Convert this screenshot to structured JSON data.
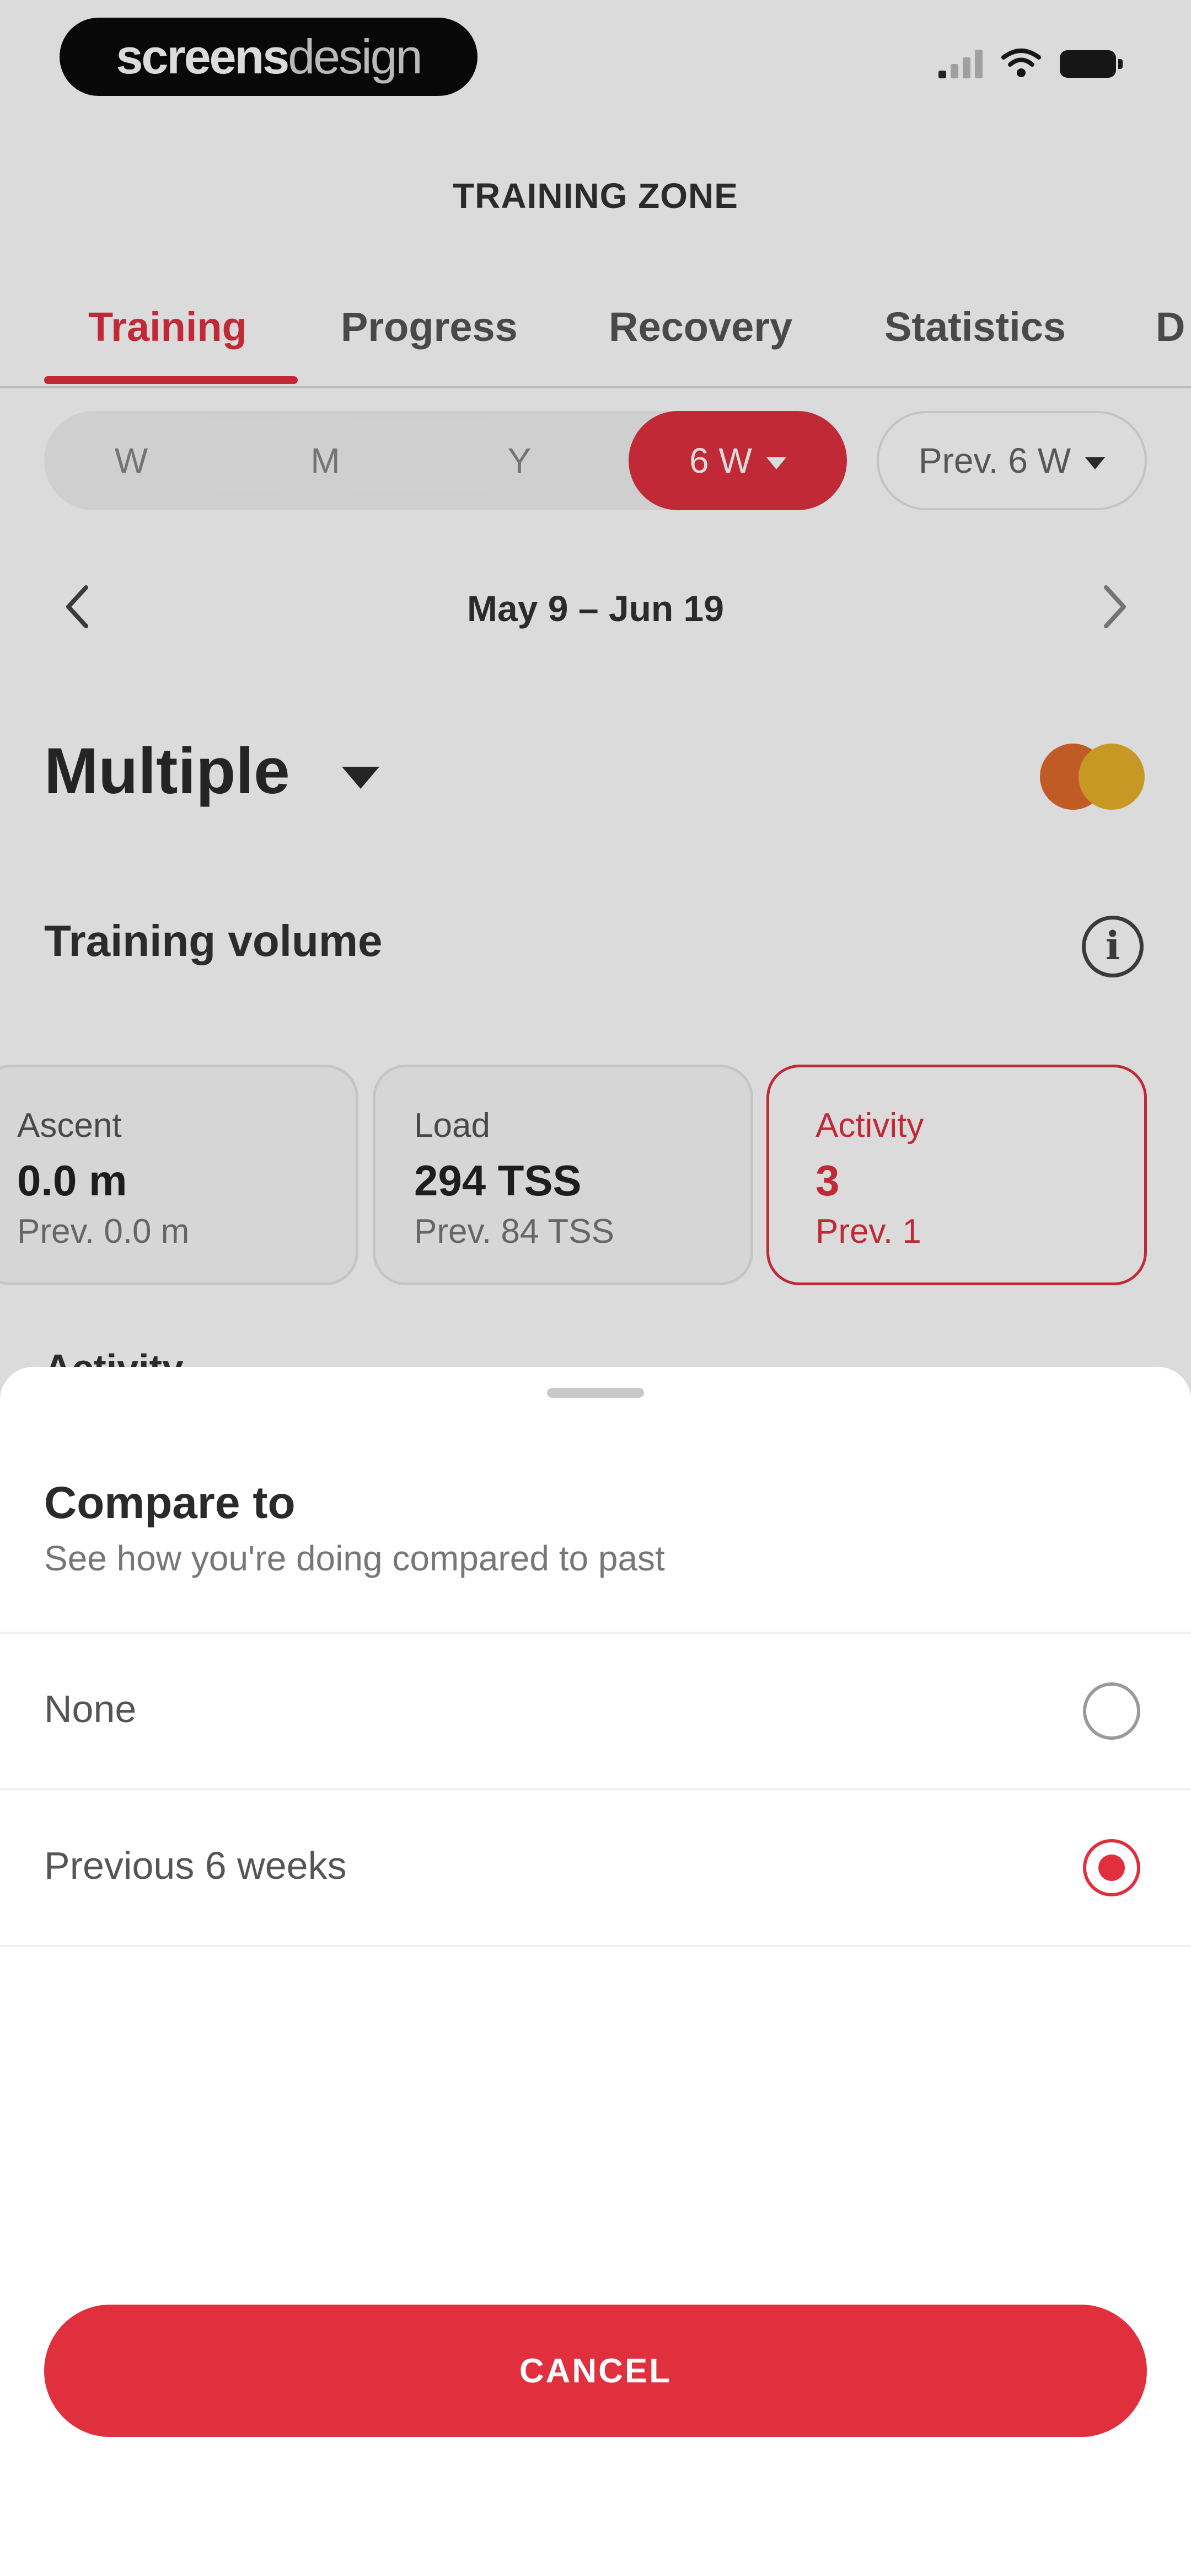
{
  "status_bar": {
    "brand_bold": "screens",
    "brand_light": "design"
  },
  "header": {
    "title": "TRAINING ZONE"
  },
  "tabs": [
    {
      "label": "Training"
    },
    {
      "label": "Progress"
    },
    {
      "label": "Recovery"
    },
    {
      "label": "Statistics"
    },
    {
      "label": "D"
    }
  ],
  "period": {
    "options": [
      "W",
      "M",
      "Y",
      "6 W"
    ],
    "selected": "6 W",
    "compare_label": "Prev. 6 W"
  },
  "date_nav": {
    "range": "May 9 – Jun 19"
  },
  "sport": {
    "label": "Multiple"
  },
  "training_volume": {
    "title": "Training volume",
    "cards": [
      {
        "label": "Ascent",
        "value": "0.0 m",
        "prev": "Prev. 0.0 m"
      },
      {
        "label": "Load",
        "value": "294 TSS",
        "prev": "Prev. 84 TSS"
      },
      {
        "label": "Activity",
        "value": "3",
        "prev": "Prev. 1"
      }
    ],
    "next_section_peek": "Activity"
  },
  "sheet": {
    "title": "Compare to",
    "subtitle": "See how you're doing compared to past",
    "options": [
      {
        "label": "None",
        "selected": false
      },
      {
        "label": "Previous 6 weeks",
        "selected": true
      }
    ],
    "cancel_label": "CANCEL"
  },
  "colors": {
    "accent": "#e0303e",
    "sport_a": "#e06a2c",
    "sport_b": "#e8b32a"
  }
}
